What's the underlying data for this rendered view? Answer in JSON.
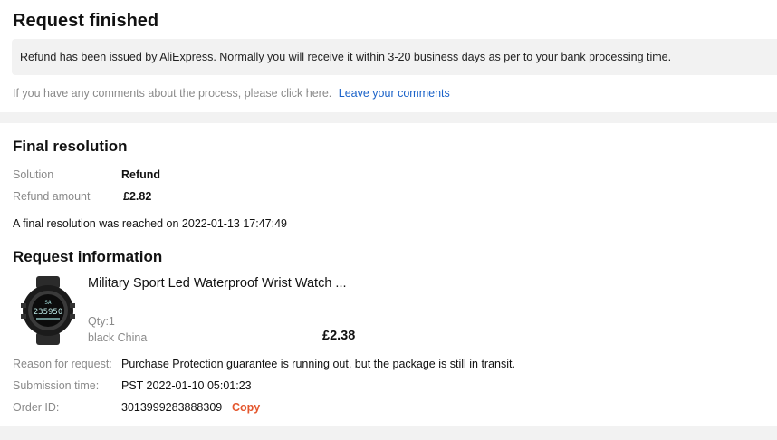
{
  "request": {
    "title": "Request finished",
    "notice": "Refund has been issued by AliExpress. Normally you will receive it within 3-20 business days as per to your bank processing time.",
    "comment_prompt": "If you have any comments about the process, please click here.",
    "comment_link": "Leave your comments"
  },
  "resolution": {
    "title": "Final resolution",
    "solution_label": "Solution",
    "solution_value": "Refund",
    "refund_label": "Refund amount",
    "refund_value": "£2.82",
    "reached_text": "A final resolution was reached on 2022-01-13 17:47:49"
  },
  "info": {
    "title": "Request information",
    "product": {
      "name": "Military Sport Led Waterproof Wrist Watch ...",
      "qty": "Qty:1",
      "variant": "black China",
      "price": "£2.38",
      "watch_display_top": "SA",
      "watch_display_main": "235950"
    },
    "reason_label": "Reason for request:",
    "reason_value": "Purchase Protection guarantee is running out, but the package is still in transit.",
    "submission_label": "Submission time:",
    "submission_value": "PST 2022-01-10 05:01:23",
    "order_label": "Order ID:",
    "order_value": "3013999283888309",
    "copy_label": "Copy"
  },
  "colors": {
    "link": "#1a62c8",
    "copy": "#e4572e",
    "panel_bg": "#f2f2f2"
  }
}
